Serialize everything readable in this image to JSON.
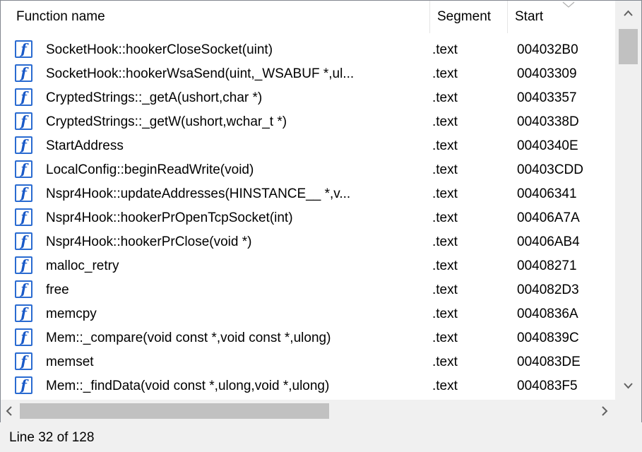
{
  "columns": {
    "name": "Function name",
    "segment": "Segment",
    "start": "Start"
  },
  "icon": "function-icon",
  "icon_glyph": "f",
  "rows": [
    {
      "name": "SocketHook::hookerCloseSocket(uint)",
      "segment": ".text",
      "start": "004032B0"
    },
    {
      "name": "SocketHook::hookerWsaSend(uint,_WSABUF *,ul...",
      "segment": ".text",
      "start": "00403309"
    },
    {
      "name": "CryptedStrings::_getA(ushort,char *)",
      "segment": ".text",
      "start": "00403357"
    },
    {
      "name": "CryptedStrings::_getW(ushort,wchar_t *)",
      "segment": ".text",
      "start": "0040338D"
    },
    {
      "name": "StartAddress",
      "segment": ".text",
      "start": "0040340E"
    },
    {
      "name": "LocalConfig::beginReadWrite(void)",
      "segment": ".text",
      "start": "00403CDD"
    },
    {
      "name": "Nspr4Hook::updateAddresses(HINSTANCE__ *,v...",
      "segment": ".text",
      "start": "00406341"
    },
    {
      "name": "Nspr4Hook::hookerPrOpenTcpSocket(int)",
      "segment": ".text",
      "start": "00406A7A"
    },
    {
      "name": "Nspr4Hook::hookerPrClose(void *)",
      "segment": ".text",
      "start": "00406AB4"
    },
    {
      "name": "malloc_retry",
      "segment": ".text",
      "start": "00408271"
    },
    {
      "name": "free",
      "segment": ".text",
      "start": "004082D3"
    },
    {
      "name": "memcpy",
      "segment": ".text",
      "start": "0040836A"
    },
    {
      "name": "Mem::_compare(void const *,void const *,ulong)",
      "segment": ".text",
      "start": "0040839C"
    },
    {
      "name": "memset",
      "segment": ".text",
      "start": "004083DE"
    },
    {
      "name": "Mem::_findData(void const *,ulong,void *,ulong)",
      "segment": ".text",
      "start": "004083F5"
    }
  ],
  "status": "Line 32 of 128",
  "colors": {
    "icon_border": "#2a6bd1",
    "scroll_thumb": "#c1c1c1",
    "background": "#f0f0f0"
  }
}
